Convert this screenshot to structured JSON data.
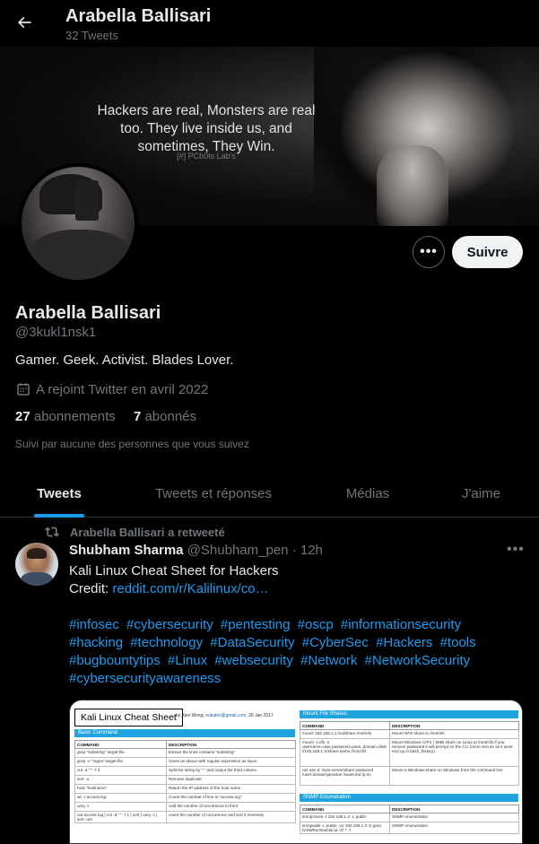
{
  "topbar": {
    "name": "Arabella Ballisari",
    "tweet_count": "32 Tweets",
    "back_icon": "arrow-left-icon"
  },
  "banner": {
    "quote": "Hackers are real, Monsters are real too. They live inside us, and sometimes, They Win.",
    "credit": "[#] PCb0ts Lab's"
  },
  "profile": {
    "follow_label": "Suivre",
    "more_icon": "more-horizontal-icon",
    "name": "Arabella Ballisari",
    "handle": "@3kukl1nsk1",
    "bio": "Gamer. Geek. Activist. Blades Lover.",
    "joined": "A rejoint Twitter en avril 2022",
    "following_count": "27",
    "following_label": "abonnements",
    "followers_count": "7",
    "followers_label": "abonnés",
    "followed_by": "Suivi par aucune des personnes que vous suivez"
  },
  "tabs": [
    {
      "label": "Tweets",
      "active": true
    },
    {
      "label": "Tweets et réponses",
      "active": false
    },
    {
      "label": "Médias",
      "active": false
    },
    {
      "label": "J'aime",
      "active": false
    }
  ],
  "tweet": {
    "retweet_label": "Arabella Ballisari a retweeté",
    "author": "Shubham Sharma",
    "author_handle": "@Shubham_pen",
    "separator": "·",
    "time": "12h",
    "line1": "Kali Linux Cheat Sheet for Hackers",
    "credit_prefix": "Credit: ",
    "credit_link": "reddit.com/r/Kalilinux/co…",
    "hashtags": [
      "#infosec",
      "#cybersecurity",
      "#pentesting",
      "#oscp",
      "#informationsecurity",
      "#hacking",
      "#technology",
      "#DataSecurity",
      "#CyberSec",
      "#Hackers",
      "#tools",
      "#bugbountytips",
      "#Linux",
      "#websecurity",
      "#Network",
      "#NetworkSecurity",
      "#cybersecurityawareness"
    ],
    "media": {
      "title": "Kali Linux Cheat Sheet",
      "author_prefix": "by Alex Wong,",
      "author_email": "eukalex@gmail.com",
      "author_date": ", 26 Jan 2017",
      "left_section": "Basic Command",
      "left_headers": [
        "COMMAND",
        "DESCRIPTION"
      ],
      "left_rows": [
        [
          "grep \"substring\" target-file",
          "Extract the lines contains \"substring\""
        ],
        [
          "grep -o \"regex\" target-file",
          "Same as above with regular expression as input"
        ],
        [
          "cut -d \":\" -f 3",
          "Split the string by \":\" and output the third column"
        ],
        [
          "sort -u",
          "Remove duplicate"
        ],
        [
          "host \"hostname\"",
          "Return the IP address of the host name"
        ],
        [
          "wc -l access.log",
          "Count the number of line in \"access.log\""
        ],
        [
          "uniq -c",
          "Add the number of occurrence in front"
        ],
        [
          "cat access.log | cut -d \" \" -f 1 | sort | uniq -c | sort -urn",
          "count the number of occurrence and sort it reversely"
        ]
      ],
      "right_section1": "Mount File Shares",
      "right_headers": [
        "COMMAND",
        "DESCRIPTION"
      ],
      "right_rows1": [
        [
          "mount 192.168.1.1:/vol/share /mnt/nfs",
          "Mount NFS share to /mnt/nfs"
        ],
        [
          "mount -t cifs -o username=user,password=pass ,domain=blah //192.168.1.X/share-name /mnt/cifs",
          "Mount Windows CIFS / SMB share on Linux at /mnt/cifs if you remove password it will prompt on the CLI (more secure as it wont end up in bash_history)"
        ],
        [
          "net use Z: \\\\win-server\\share password /user:domain\\janedoe /savecred /p:no",
          "Mount a Windows share on Windows from the command line"
        ]
      ],
      "right_section2": "SNMP Enumeration",
      "right_rows2": [
        [
          "snmpcheck -t 192.168.1.X -c public",
          "SNMP enumeration"
        ],
        [
          "snmpwalk -c public -v1 192.168.1.X 1| grep hrSWRunName|cut -d* * -f",
          "SNMP enumeration"
        ]
      ]
    }
  },
  "colors": {
    "background": "#000000",
    "text_primary": "#e7e9ea",
    "text_secondary": "#71767b",
    "accent": "#1d9bf0",
    "follow_button_bg": "#eff3f4",
    "cheat_sheet_blue": "#1fa4e0"
  }
}
